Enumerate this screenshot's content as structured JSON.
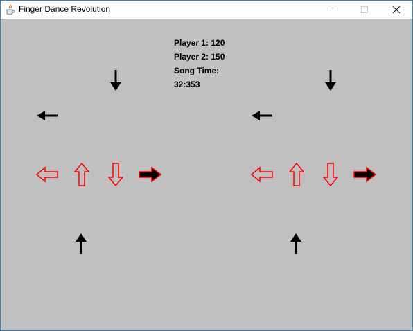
{
  "window": {
    "title": "Finger Dance Revolution",
    "app_icon": "java-cup-icon",
    "controls": {
      "minimize_icon": "minimize-icon",
      "maximize_icon": "maximize-icon",
      "close_icon": "close-icon"
    }
  },
  "hud": {
    "player1": "Player 1: 120",
    "player2": "Player 2: 150",
    "song_time_label": "Song Time:",
    "song_time_value": "32:353"
  },
  "colors": {
    "background": "#c0c0c0",
    "target_outline": "#ff0000",
    "note_arrow": "#000000",
    "titlebar": "#ffffff",
    "window_border": "#3c7fb1"
  },
  "players": [
    {
      "name": "player-1-lane",
      "targets": [
        "left",
        "up",
        "down",
        "right"
      ],
      "notes": [
        "down",
        "left",
        "up"
      ]
    },
    {
      "name": "player-2-lane",
      "targets": [
        "left",
        "up",
        "down",
        "right"
      ],
      "notes": [
        "down",
        "left",
        "up"
      ]
    }
  ]
}
